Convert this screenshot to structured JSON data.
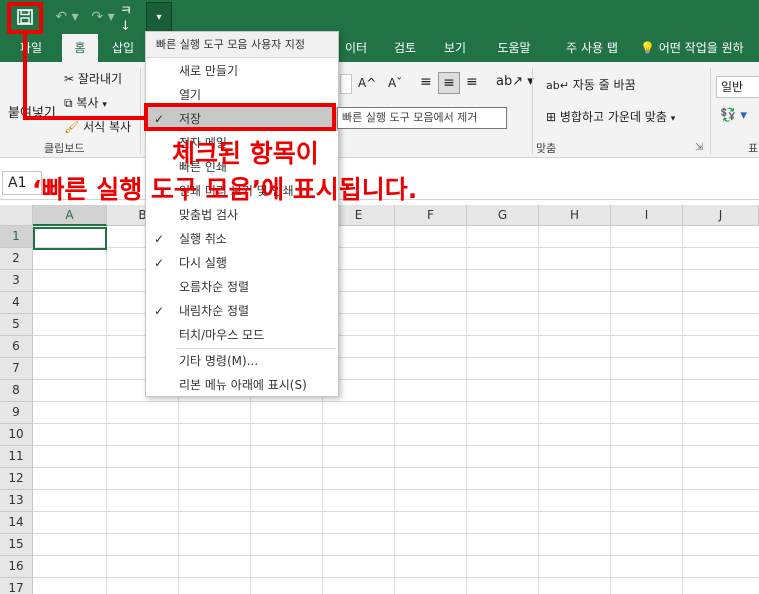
{
  "qat": {
    "save_icon": "save-icon",
    "undo_icon": "undo-icon",
    "redo_icon": "redo-icon",
    "sort_icon": "sort-icon",
    "customize_icon": "chevron-down-icon"
  },
  "tabs": [
    {
      "label": "파일"
    },
    {
      "label": "홈"
    },
    {
      "label": "삽입"
    },
    {
      "label": "이터"
    },
    {
      "label": "검토"
    },
    {
      "label": "보기"
    },
    {
      "label": "도움말"
    },
    {
      "label": "주 사용 탭"
    },
    {
      "label": "어떤 작업을 원하"
    }
  ],
  "ribbon": {
    "cut": "잘라내기",
    "copy": "복사",
    "paste_partial": "붙여넣기",
    "format_painter": "서식 복사",
    "clipboard_group": "클립보드",
    "wrap_text": "자동 줄 바꿈",
    "merge_center": "병합하고 가운데 맞춤",
    "align_group": "맞춤",
    "number_format": "일반",
    "number_group_partial": "표"
  },
  "formula_bar": {
    "name_box": "A1"
  },
  "grid": {
    "columns": [
      "A",
      "B",
      "C",
      "D",
      "E",
      "F",
      "G",
      "H",
      "I",
      "J"
    ],
    "rows": [
      "1",
      "2",
      "3",
      "4",
      "5",
      "6",
      "7",
      "8",
      "9",
      "10",
      "11",
      "12",
      "13",
      "14",
      "15",
      "16",
      "17"
    ]
  },
  "menu": {
    "header": "빠른 실행 도구 모음 사용자 지정",
    "items": [
      {
        "label": "새로 만들기",
        "checked": false
      },
      {
        "label": "열기",
        "checked": false
      },
      {
        "label": "저장",
        "checked": true
      },
      {
        "label": "전자 메일",
        "checked": false
      },
      {
        "label": "빠른 인쇄",
        "checked": false
      },
      {
        "label": "인쇄 미리 보기 및 인쇄",
        "checked": false
      },
      {
        "label": "맞춤법 검사",
        "checked": false
      },
      {
        "label": "실행 취소",
        "checked": true
      },
      {
        "label": "다시 실행",
        "checked": true
      },
      {
        "label": "오름차순 정렬",
        "checked": false
      },
      {
        "label": "내림차순 정렬",
        "checked": true
      },
      {
        "label": "터치/마우스 모드",
        "checked": false
      },
      {
        "label": "기타 명령(M)...",
        "checked": false
      },
      {
        "label": "리본 메뉴 아래에 표시(S)",
        "checked": false
      }
    ],
    "check_glyph": "✓"
  },
  "tooltip": "빠른 실행 도구 모음에서 제거",
  "annotation": {
    "line1": "체크된 항목이",
    "line2": "‘빠른 실행 도구 모음’에 표시됩니다."
  }
}
